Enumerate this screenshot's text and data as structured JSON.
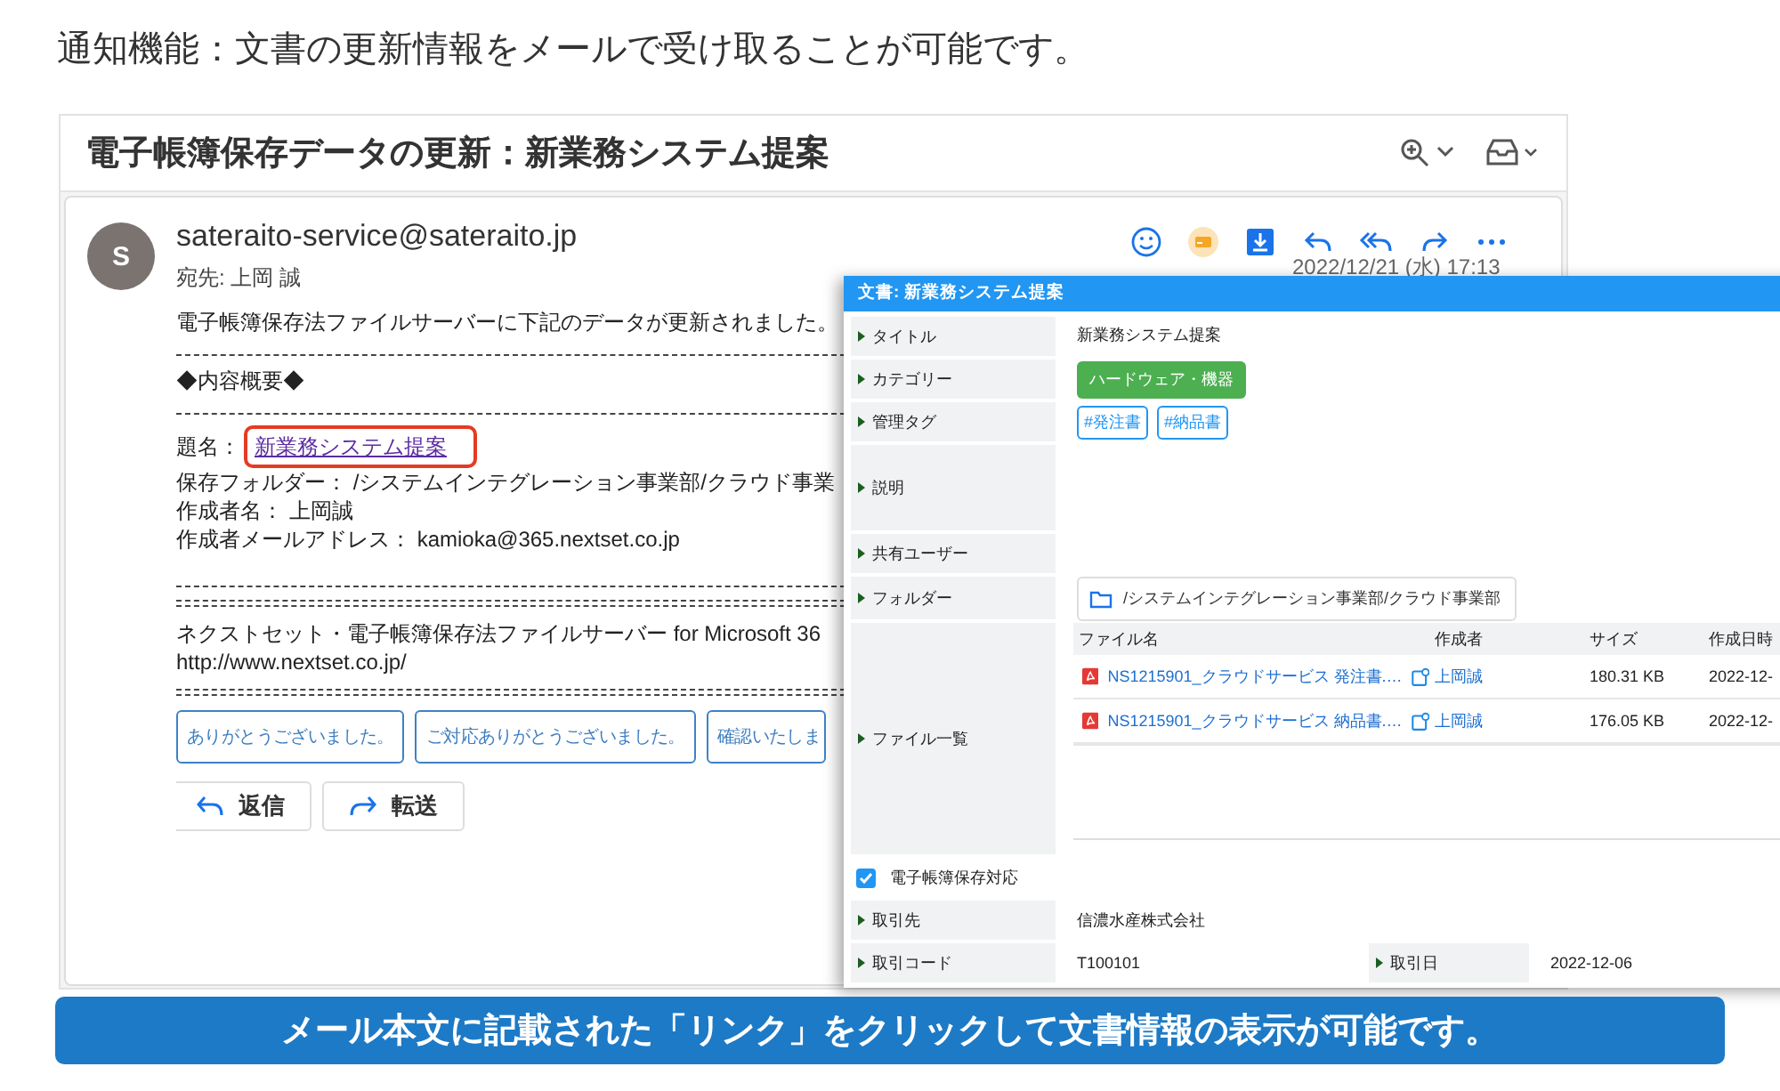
{
  "heading": "通知機能：文書の更新情報をメールで受け取ることが可能です。",
  "email": {
    "subject": "電子帳簿保存データの更新：新業務システム提案",
    "sender_initial": "S",
    "sender": "sateraito-service@sateraito.jp",
    "to": "宛先: 上岡 誠",
    "date": "2022/12/21 (水) 17:13",
    "intro": "電子帳簿保存法ファイルサーバーに下記のデータが更新されました。",
    "summary_heading": "◆内容概要◆",
    "title_label": "題名：",
    "title_link": "新業務システム提案",
    "lines": [
      "保存フォルダー： /システムインテグレーション事業部/クラウド事業",
      "作成者名： 上岡誠",
      "作成者メールアドレス： kamioka@365.nextset.co.jp"
    ],
    "footer": [
      "ネクストセット・電子帳簿保存法ファイルサーバー for Microsoft 36",
      "http://www.nextset.co.jp/"
    ],
    "quick_replies": [
      "ありがとうございました。",
      "ご対応ありがとうございました。",
      "確認いたしま"
    ],
    "actions": [
      {
        "kind": "reply",
        "label": "返信"
      },
      {
        "kind": "forward",
        "label": "転送"
      }
    ]
  },
  "document": {
    "title": "文書: 新業務システム提案",
    "fields": [
      {
        "kind": "text",
        "label": "タイトル",
        "value": "新業務システム提案"
      },
      {
        "kind": "category",
        "label": "カテゴリー",
        "value": "ハードウェア・機器"
      },
      {
        "kind": "tags",
        "label": "管理タグ",
        "tags": [
          "#発注書",
          "#納品書"
        ]
      },
      {
        "kind": "tall",
        "label": "説明"
      },
      {
        "kind": "empty",
        "label": "共有ユーザー"
      },
      {
        "kind": "folder",
        "label": "フォルダー",
        "value": "/システムインテグレーション事業部/クラウド事業部"
      },
      {
        "kind": "files",
        "label": "ファイル一覧"
      }
    ],
    "files": {
      "columns": [
        "ファイル名",
        "作成者",
        "サイズ",
        "作成日時"
      ],
      "rows": [
        {
          "name": "NS1215901_クラウドサービス 発注書.…",
          "author": "上岡誠",
          "size": "180.31 KB",
          "created": "2022-12-"
        },
        {
          "name": "NS1215901_クラウドサービス 納品書.…",
          "author": "上岡誠",
          "size": "176.05 KB",
          "created": "2022-12-"
        }
      ]
    },
    "compliance": {
      "label": "電子帳簿保存対応",
      "checked": true
    },
    "partner_label": "取引先",
    "partner": "信濃水産株式会社",
    "code_label": "取引コード",
    "code": "T100101",
    "date_label": "取引日",
    "date": "2022-12-06"
  },
  "banner": "メール本文に記載された「リンク」をクリックして文書情報の表示が可能です。"
}
